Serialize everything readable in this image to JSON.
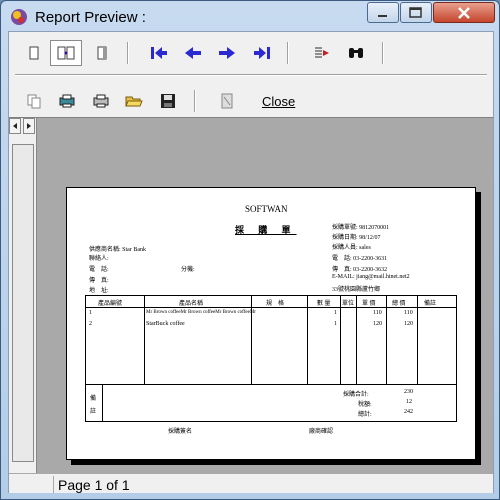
{
  "window": {
    "title": "Report Preview :"
  },
  "toolbar1": {
    "buttons": [
      {
        "name": "single-page-icon"
      },
      {
        "name": "two-page-icon"
      },
      {
        "name": "page-width-icon"
      },
      {
        "name": "first-page-icon"
      },
      {
        "name": "previous-page-icon"
      },
      {
        "name": "next-page-icon"
      },
      {
        "name": "last-page-icon"
      },
      {
        "name": "goto-page-icon"
      },
      {
        "name": "find-binoculars-icon"
      }
    ]
  },
  "toolbar2": {
    "close_label": "Close"
  },
  "document": {
    "company": "SOFTWAN",
    "form_title": "採 購 單",
    "header_left": [
      "供應商名稱: Star Bank",
      "聯絡人:",
      "電　話:",
      "傳　真:",
      "地　址:"
    ],
    "header_mid": "分機:",
    "header_right": [
      "採購單號: 9812070001",
      "採購日期: 98/12/07",
      "採購人員: sales",
      "電　話: 03-2200-3631",
      "傳　真: 03-2200-3632",
      "E-MAIL: jiang@mail.hinet.net2",
      "33號桃園縣蘆竹鄉"
    ],
    "columns": [
      "產品編號",
      "產品名稱",
      "規　格",
      "數 量",
      "單位",
      "單 價",
      "總 價",
      "備註"
    ],
    "rows": [
      {
        "no": "1",
        "name": "Mr Brown coffeeMr Brown coffeeMr Brown coffeeMr",
        "qty": "1",
        "price": "110",
        "total": "110"
      },
      {
        "no": "2",
        "name": "StarBuck coffee",
        "qty": "1",
        "price": "120",
        "total": "120"
      }
    ],
    "remark_label": "備\n註",
    "subtotal_label": "採購合計:",
    "subtotal_value": "230",
    "tax_label": "稅額:",
    "tax_value": "12",
    "total_label": "總計:",
    "total_value": "242",
    "sign_left": "採購簽名",
    "sign_right": "廠商確認"
  },
  "status": {
    "page_text": "Page 1 of 1"
  }
}
